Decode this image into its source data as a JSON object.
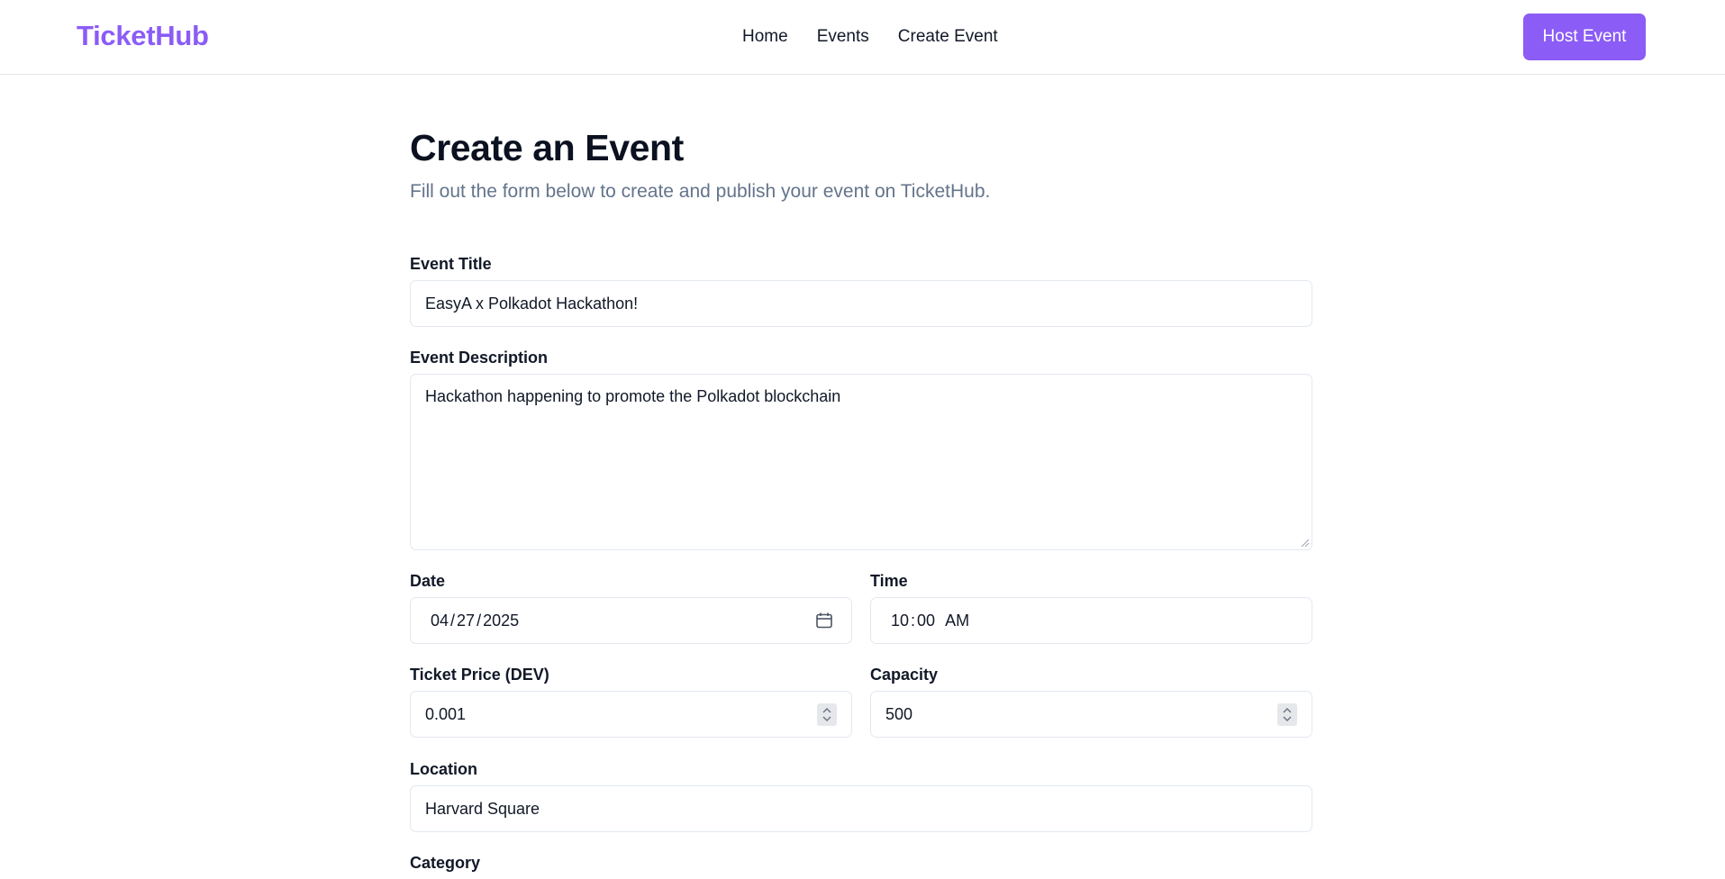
{
  "header": {
    "logo": "TicketHub",
    "nav": [
      "Home",
      "Events",
      "Create Event"
    ],
    "host_button": "Host Event"
  },
  "page": {
    "title": "Create an Event",
    "subtitle": "Fill out the form below to create and publish your event on TicketHub."
  },
  "form": {
    "title_label": "Event Title",
    "title_value": "EasyA x Polkadot Hackathon!",
    "description_label": "Event Description",
    "description_value": "Hackathon happening to promote the Polkadot blockchain",
    "date_label": "Date",
    "date_month": "04",
    "date_day": "27",
    "date_year": "2025",
    "time_label": "Time",
    "time_hour": "10",
    "time_minute": "00",
    "time_period": "AM",
    "price_label": "Ticket Price (DEV)",
    "price_value": "0.001",
    "capacity_label": "Capacity",
    "capacity_value": "500",
    "location_label": "Location",
    "location_value": "Harvard Square",
    "category_label": "Category"
  },
  "colors": {
    "accent": "#8b5cf6",
    "border": "#e2e8f0",
    "muted_text": "#64748b"
  },
  "icons": [
    "calendar-icon",
    "spinner-icon",
    "resize-handle-icon"
  ]
}
